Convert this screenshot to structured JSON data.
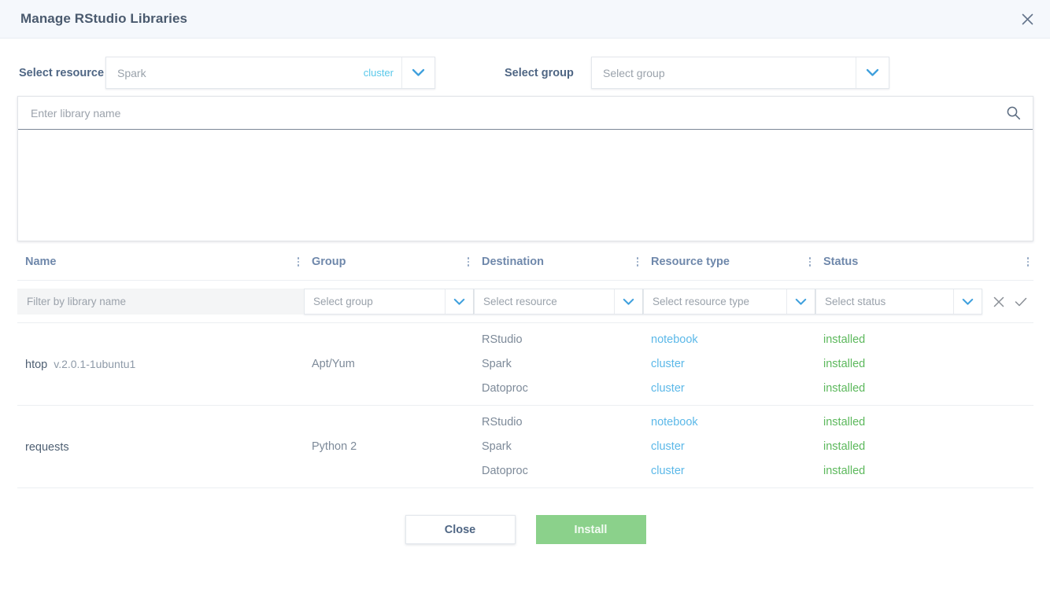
{
  "dialog": {
    "title": "Manage RStudio Libraries",
    "close_icon": "close-icon"
  },
  "selectors": {
    "resource": {
      "label": "Select resource",
      "value": "Spark",
      "tag": "cluster",
      "arrow_icon": "chevron-down-icon"
    },
    "group": {
      "label": "Select group",
      "value": "",
      "placeholder": "Select group",
      "arrow_icon": "chevron-down-icon"
    }
  },
  "search": {
    "placeholder": "Enter library name",
    "value": "",
    "icon": "search-icon",
    "results": []
  },
  "table": {
    "columns": [
      {
        "label": "Name",
        "menu_icon": "kebab-menu-icon"
      },
      {
        "label": "Group",
        "menu_icon": "kebab-menu-icon"
      },
      {
        "label": "Destination",
        "menu_icon": "kebab-menu-icon"
      },
      {
        "label": "Resource type",
        "menu_icon": "kebab-menu-icon"
      },
      {
        "label": "Status",
        "menu_icon": "kebab-menu-icon"
      }
    ],
    "filters": {
      "name_placeholder": "Filter by library name",
      "name_value": "",
      "group_placeholder": "Select group",
      "resource_placeholder": "Select resource",
      "resource_type_placeholder": "Select resource type",
      "status_placeholder": "Select status",
      "clear_icon": "close-icon",
      "apply_icon": "check-icon"
    },
    "rows": [
      {
        "name": "htop",
        "version": "v.2.0.1-1ubuntu1",
        "group": "Apt/Yum",
        "destinations": [
          "RStudio",
          "Spark",
          "Datoproc"
        ],
        "resource_types": [
          "notebook",
          "cluster",
          "cluster"
        ],
        "statuses": [
          "installed",
          "installed",
          "installed"
        ]
      },
      {
        "name": "requests",
        "version": "",
        "group": "Python 2",
        "destinations": [
          "RStudio",
          "Spark",
          "Datoproc"
        ],
        "resource_types": [
          "notebook",
          "cluster",
          "cluster"
        ],
        "statuses": [
          "installed",
          "installed",
          "installed"
        ]
      }
    ]
  },
  "footer": {
    "close_label": "Close",
    "install_label": "Install"
  },
  "colors": {
    "header_bg": "#f5f8fc",
    "title": "#4a5a6e",
    "label": "#4f6684",
    "column_header": "#6f88ab",
    "accent_cyan": "#5bb8e8",
    "status_green": "#5cb85c",
    "install_button": "#8bd18b",
    "muted_text": "#7d8a99"
  }
}
